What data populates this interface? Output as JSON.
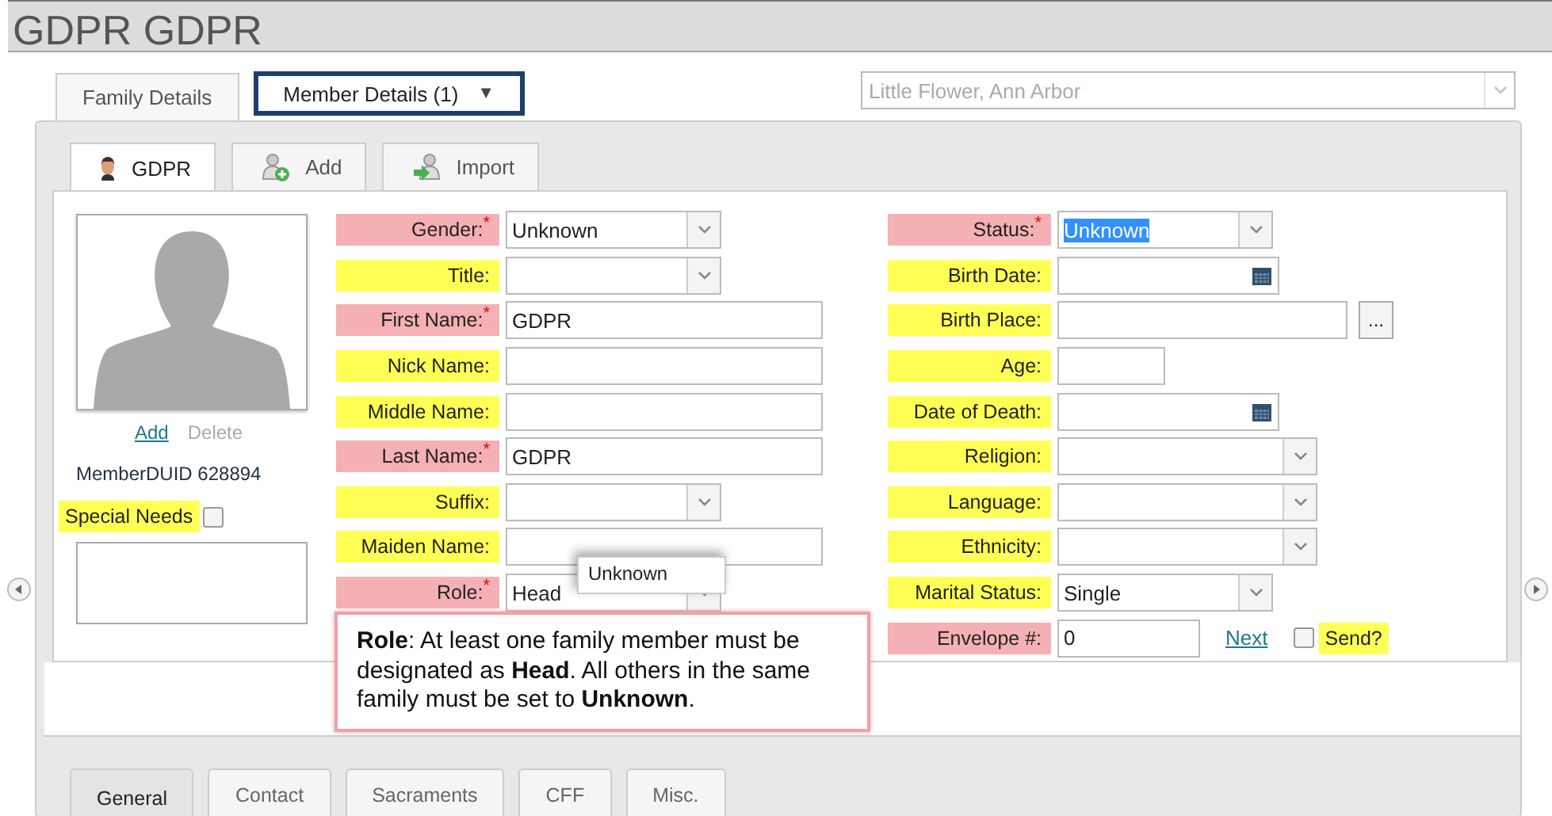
{
  "header": {
    "title": "GDPR GDPR"
  },
  "top_tabs": [
    {
      "label": "Family Details",
      "selected": false
    },
    {
      "label": "Member Details (1)",
      "selected": true,
      "caret": "▼"
    }
  ],
  "parish_select": {
    "value": "Little Flower, Ann Arbor",
    "disabled": true
  },
  "member_tabs": [
    {
      "label": "GDPR",
      "kind": "member",
      "selected": true
    },
    {
      "label": "Add",
      "kind": "add",
      "selected": false
    },
    {
      "label": "Import",
      "kind": "import",
      "selected": false
    }
  ],
  "photo": {
    "links": [
      {
        "label": "Add",
        "disabled": false
      },
      {
        "label": "Delete",
        "disabled": true
      }
    ],
    "duid": "MemberDUID 628894",
    "special_needs": {
      "label": "Special Needs",
      "checked": false
    }
  },
  "columns": [
    [
      {
        "label": "Gender:$^{*}$",
        "required": true,
        "kind": "select",
        "value": "Unknown",
        "highlighted": false
      },
      {
        "label": "Title:",
        "required": false,
        "kind": "select"
      },
      {
        "label": "First Name:$^{*}$",
        "required": true,
        "kind": "text",
        "value": "GDPR",
        "highlighted": false
      },
      {
        "label": "Nick Name:",
        "required": false,
        "kind": "text"
      },
      {
        "label": "Middle Name:",
        "required": false,
        "kind": "text"
      },
      {
        "label": "Last Name:$^{*}$",
        "required": true,
        "kind": "text",
        "value": "GDPR",
        "highlighted": false
      },
      {
        "label": "Suffix:",
        "required": false,
        "kind": "select"
      },
      {
        "label": "Maiden Name:",
        "required": false,
        "kind": "text"
      },
      {
        "label": "Role:$^{*}$",
        "required": true,
        "kind": "select",
        "value": "Head",
        "highlighted": false,
        "dropdown": [
          "Unknown"
        ]
      }
    ],
    [
      {
        "label": "Status:$^{*}$",
        "required": true,
        "kind": "select",
        "value": "Unknown",
        "highlighted": true
      },
      {
        "label": "Birth Date:",
        "required": false,
        "kind": "date"
      },
      {
        "label": "Birth Place:",
        "required": false,
        "kind": "place",
        "button": "..."
      },
      {
        "label": "Age:",
        "required": false,
        "kind": "age"
      },
      {
        "label": "Date of Death:",
        "required": false,
        "kind": "date"
      },
      {
        "label": "Religion:",
        "required": false,
        "kind": "wideselect"
      },
      {
        "label": "Language:",
        "required": false,
        "kind": "wideselect"
      },
      {
        "label": "Ethnicity:",
        "required": false,
        "kind": "wideselect"
      },
      {
        "label": "Marital Status:",
        "required": false,
        "kind": "select",
        "value": "Single",
        "highlighted": false
      },
      {
        "label": "Envelope #:",
        "required": true,
        "kind": "number",
        "value": "0",
        "link": "Next",
        "send": {
          "label": "Send?",
          "checked": false
        },
        "highlighted": false
      }
    ]
  ],
  "tooltip": {
    "text": "**Role**: At least one family member must be designated as **Head**. All others in the same family must be set to **Unknown**."
  },
  "bottom_tabs": [
    {
      "label": "General",
      "selected": true
    },
    {
      "label": "Contact",
      "selected": false
    },
    {
      "label": "Sacraments",
      "selected": false
    },
    {
      "label": "CFF",
      "selected": false
    },
    {
      "label": "Misc.",
      "selected": false
    }
  ]
}
